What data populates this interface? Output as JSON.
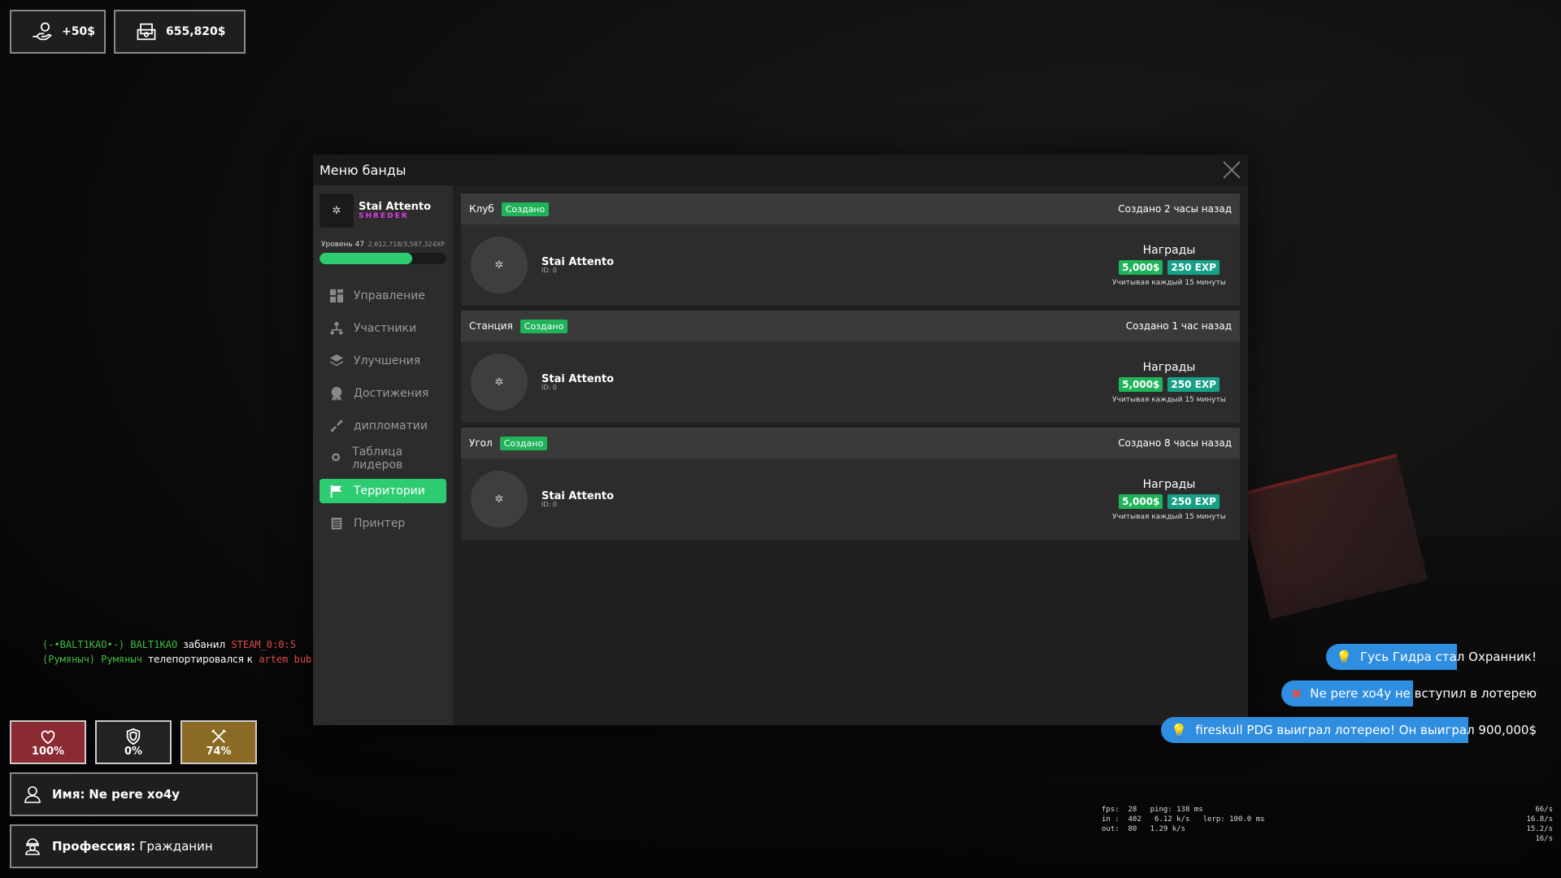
{
  "hud": {
    "income": "+50$",
    "balance": "655,820$",
    "health": "100%",
    "armor": "0%",
    "hunger": "74%",
    "name_label": "Имя:",
    "name_value": "Ne pere xo4y",
    "job_label": "Профессия:",
    "job_value": "Гражданин"
  },
  "modal": {
    "title": "Меню банды",
    "profile": {
      "name": "Stai Attento",
      "rank": "SHREDER",
      "level": "Уровень 47",
      "xp": "2,612,718/3,587,324XP",
      "progress_percent": 73
    },
    "nav": [
      {
        "label": "Управление",
        "icon": "dashboard-icon"
      },
      {
        "label": "Участники",
        "icon": "members-icon"
      },
      {
        "label": "Улучшения",
        "icon": "layers-icon"
      },
      {
        "label": "Достижения",
        "icon": "award-icon"
      },
      {
        "label": "дипломатии",
        "icon": "link-icon"
      },
      {
        "label": "Таблица лидеров",
        "icon": "leaderboard-icon"
      },
      {
        "label": "Территории",
        "icon": "flag-icon",
        "active": true
      },
      {
        "label": "Принтер",
        "icon": "printer-icon"
      }
    ],
    "territories": [
      {
        "name": "Клуб",
        "status": "Создано",
        "time": "Создано 2 часы назад",
        "owner": "Stai Attento",
        "owner_id": "ID: 0",
        "rewards_title": "Награды",
        "money": "5,000$",
        "exp": "250 EXP",
        "note": "Учитывая каждый 15 минуты"
      },
      {
        "name": "Станция",
        "status": "Создано",
        "time": "Создано 1 час назад",
        "owner": "Stai Attento",
        "owner_id": "ID: 0",
        "rewards_title": "Награды",
        "money": "5,000$",
        "exp": "250 EXP",
        "note": "Учитывая каждый 15 минуты"
      },
      {
        "name": "Угол",
        "status": "Создано",
        "time": "Создано 8 часы назад",
        "owner": "Stai Attento",
        "owner_id": "ID: 0",
        "rewards_title": "Награды",
        "money": "5,000$",
        "exp": "250 EXP",
        "note": "Учитывая каждый 15 минуты"
      }
    ]
  },
  "chat": [
    {
      "tag": "(-•BALT1KAO•-) BALT1KAO",
      "action": "забанил",
      "target": "STEAM_0:0:5"
    },
    {
      "tag": "(Румяныч) Румяныч",
      "action": "телепортировался к",
      "target": "artem bub"
    }
  ],
  "notifications": [
    {
      "text": "Гусь Гидра стал Охранник!",
      "icon": "bulb-icon",
      "progress": 0.6
    },
    {
      "text": "Ne pere xo4y не вступил в лотерею",
      "icon": "error-icon",
      "progress": 0.5
    },
    {
      "text": "fireskull PDG выиграл лотерею! Он выиграл 900,000$",
      "icon": "bulb-icon",
      "progress": 0.8
    }
  ],
  "netgraph": {
    "left": "fps:  28   ping: 138 ms\nin :  402   6.12 k/s   lerp: 100.0 ms\nout:  80   1.29 k/s",
    "right": [
      "66/s",
      "16.8/s",
      "15.2/s",
      "16/s"
    ]
  },
  "colors": {
    "accent": "#2ecc71",
    "rank": "#e03ae8",
    "notif": "#2f8ee0"
  }
}
